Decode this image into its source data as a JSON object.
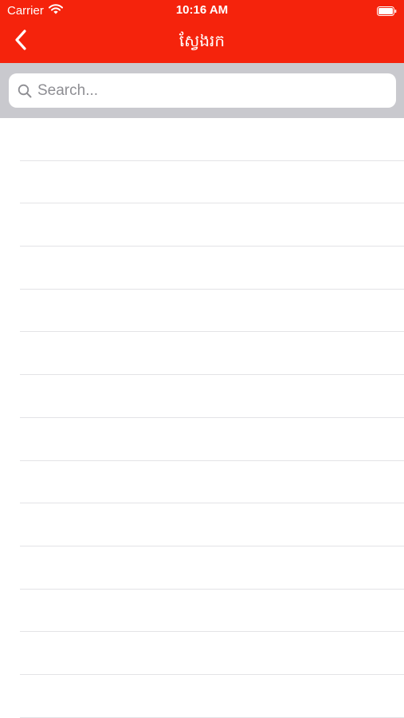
{
  "status_bar": {
    "carrier": "Carrier",
    "time": "10:16 AM"
  },
  "nav": {
    "title": "ស្វែងរក"
  },
  "search": {
    "placeholder": "Search...",
    "value": ""
  },
  "colors": {
    "header": "#f5230c",
    "search_area": "#c9c9ce",
    "separator": "#e3e3e6"
  },
  "list": {
    "items": [
      "",
      "",
      "",
      "",
      "",
      "",
      "",
      "",
      "",
      "",
      "",
      "",
      "",
      ""
    ]
  }
}
